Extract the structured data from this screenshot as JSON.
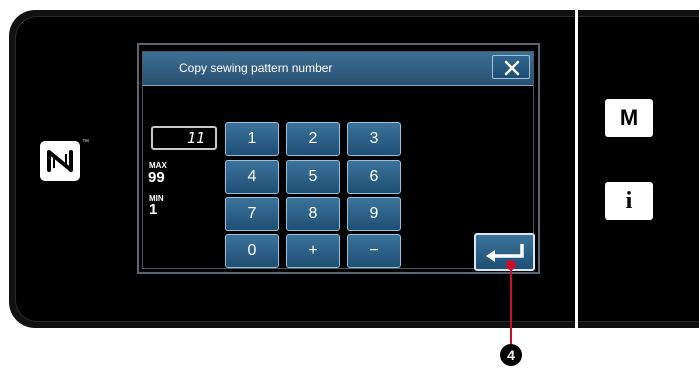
{
  "dialog": {
    "title": "Copy sewing pattern number",
    "close_icon": "close-icon"
  },
  "input": {
    "value": "11"
  },
  "limits": {
    "max_label": "MAX",
    "max_value": "99",
    "min_label": "MIN",
    "min_value": "1"
  },
  "keypad": {
    "keys": [
      "1",
      "2",
      "3",
      "4",
      "5",
      "6",
      "7",
      "8",
      "9",
      "0",
      "+",
      "−"
    ],
    "enter_icon": "enter-icon"
  },
  "side_buttons": {
    "menu_label": "M",
    "info_label": "i"
  },
  "device": {
    "nfc_icon": "nfc-icon",
    "nfc_tm": "™"
  },
  "callout": {
    "number": "4"
  },
  "colors": {
    "key_blue": "#2a5f86",
    "titlebar_blue": "#3e6f93",
    "callout_red": "#c8102e"
  }
}
